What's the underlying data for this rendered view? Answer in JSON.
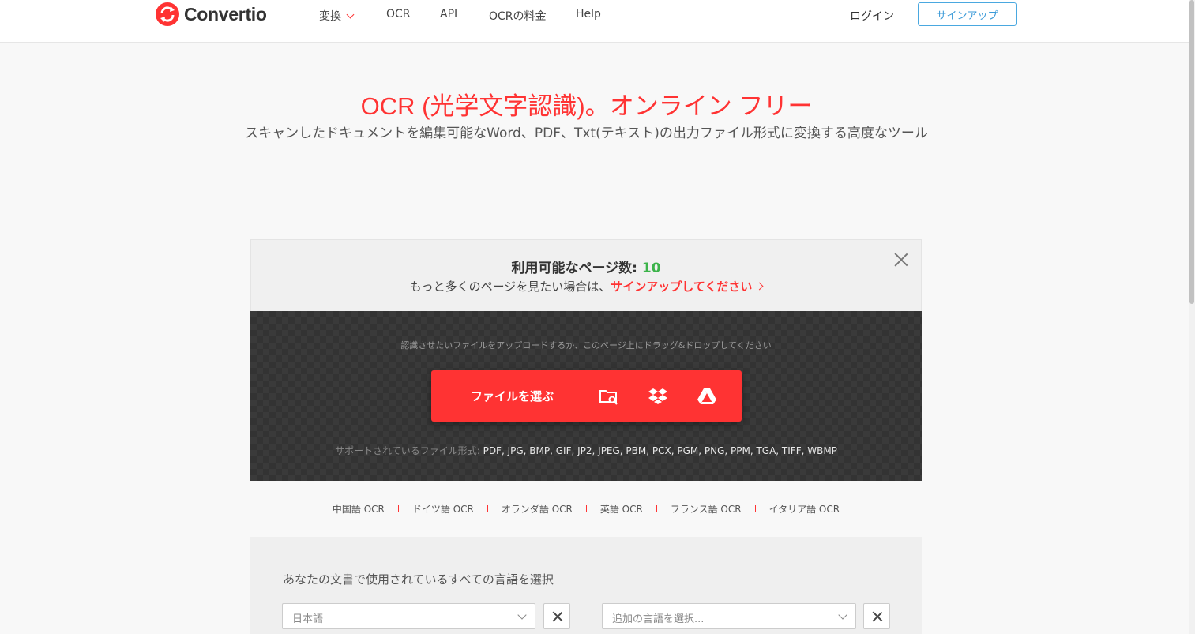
{
  "header": {
    "logo_text": "Convertio",
    "nav": [
      {
        "label": "変換"
      },
      {
        "label": "OCR"
      },
      {
        "label": "API"
      },
      {
        "label": "OCRの料金"
      },
      {
        "label": "Help"
      }
    ],
    "login": "ログイン",
    "signup": "サインアップ"
  },
  "hero": {
    "title": "OCR (光学文字認識)。オンライン フリー",
    "subtitle": "スキャンしたドキュメントを編集可能なWord、PDF、Txt(テキスト)の出力ファイル形式に変換する高度なツール"
  },
  "notice": {
    "pages_label": "利用可能なページ数: ",
    "pages_count": "10",
    "more_text": "もっと多くのページを見たい場合は、",
    "more_link": "サインアップしてください"
  },
  "upload": {
    "hint": "認識させたいファイルをアップロードするか、このページ上にドラッグ&ドロップしてください",
    "choose_label": "ファイルを選ぶ",
    "formats_label": "サポートされているファイル形式: ",
    "formats": "PDF, JPG, BMP, GIF, JP2, JPEG, PBM, PCX, PGM, PNG, PPM, TGA, TIFF, WBMP"
  },
  "languages": [
    "中国語 OCR",
    "ドイツ語 OCR",
    "オランダ語 OCR",
    "英語 OCR",
    "フランス語 OCR",
    "イタリア語 OCR"
  ],
  "lang_select": {
    "title": "あなたの文書で使用されているすべての言語を選択",
    "primary": "日本語",
    "additional_placeholder": "追加の言語を選択..."
  },
  "colors": {
    "accent": "#ff3333",
    "count_green": "#3cb34a",
    "signup_blue": "#3a9ad8"
  }
}
